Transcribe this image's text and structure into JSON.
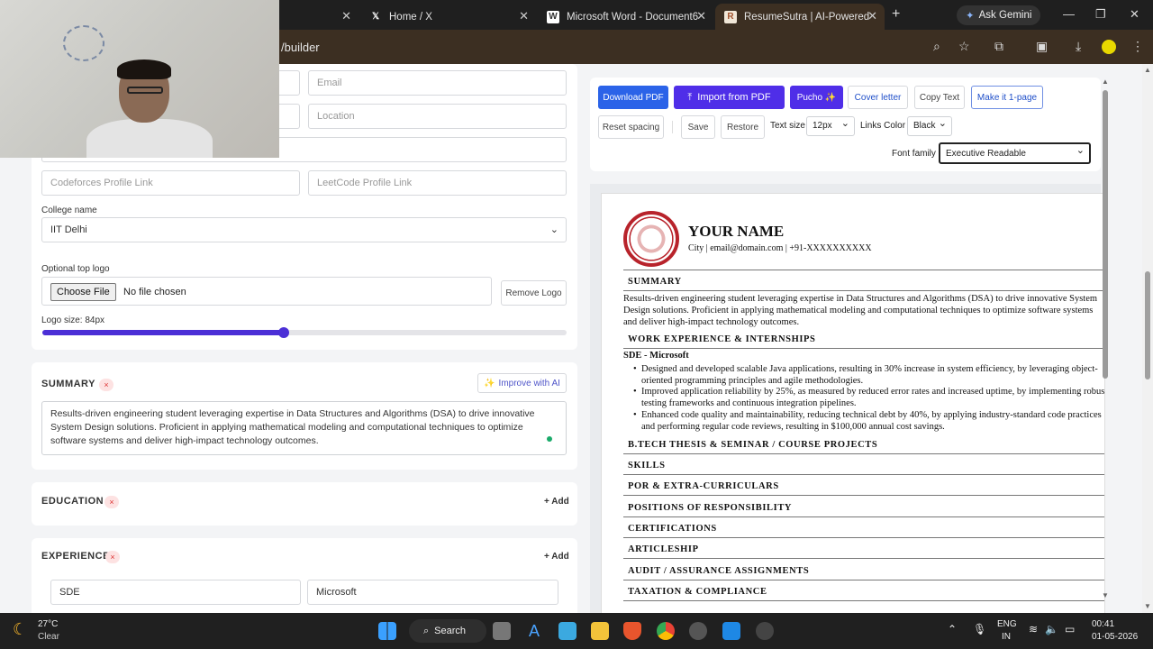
{
  "browser": {
    "tabs": [
      {
        "label": "",
        "favicon": "generic"
      },
      {
        "label": "Home / X",
        "favicon": "x-logo"
      },
      {
        "label": "Microsoft Word - Document6",
        "favicon": "word"
      },
      {
        "label": "ResumeSutra | AI-Powered ATS",
        "favicon": "resume"
      }
    ],
    "new_tab": "+",
    "ask_gemini": "Ask Gemini",
    "url": "/builder"
  },
  "form": {
    "email_placeholder": "Email",
    "location_placeholder": "Location",
    "codeforces_placeholder": "Codeforces Profile Link",
    "leetcode_placeholder": "LeetCode Profile Link",
    "college_label": "College name",
    "college_value": "IIT Delhi",
    "logo_label": "Optional top logo",
    "choose_file": "Choose File",
    "no_file": "No file chosen",
    "remove_logo": "Remove Logo",
    "logo_size_label": "Logo size: 84px",
    "logo_size_fraction": 0.46
  },
  "summary": {
    "title": "SUMMARY",
    "remove": "×",
    "improve": "Improve with AI",
    "text": "Results-driven engineering student leveraging expertise in Data Structures and Algorithms (DSA) to drive innovative System Design solutions. Proficient in applying mathematical modeling and computational techniques to optimize software systems and deliver high-impact technology outcomes."
  },
  "education": {
    "title": "EDUCATION",
    "remove": "×",
    "add": "+ Add"
  },
  "experience": {
    "title": "EXPERIENCE",
    "remove": "×",
    "add": "+ Add",
    "role": "SDE",
    "company": "Microsoft"
  },
  "toolbar": {
    "download_pdf": "Download PDF",
    "import_pdf": "Import from PDF",
    "pucho": "Pucho ✨",
    "cover_letter": "Cover letter",
    "copy_text": "Copy Text",
    "make_1page": "Make it 1-page",
    "reset_spacing": "Reset spacing",
    "save": "Save",
    "restore": "Restore",
    "text_size_label": "Text size",
    "text_size": "12px",
    "links_color_label": "Links Color",
    "links_color": "Black",
    "font_family_label": "Font family",
    "font_family": "Executive Readable"
  },
  "resume": {
    "name": "YOUR NAME",
    "contact": "City | email@domain.com | +91-XXXXXXXXXX",
    "summary_heading": "SUMMARY",
    "summary_text": "Results-driven engineering student leveraging expertise in Data Structures and Algorithms (DSA) to drive innovative System Design solutions. Proficient in applying mathematical modeling and computational techniques to optimize software systems and deliver high-impact technology outcomes.",
    "work_heading": "WORK EXPERIENCE & INTERNSHIPS",
    "job_title": "SDE - Microsoft",
    "bullets": [
      "Designed and developed scalable Java applications, resulting in 30% increase in system efficiency, by leveraging object-oriented programming principles and agile methodologies.",
      "Improved application reliability by 25%, as measured by reduced error rates and increased uptime, by implementing robust testing frameworks and continuous integration pipelines.",
      "Enhanced code quality and maintainability, reducing technical debt by 40%, by applying industry-standard code practices and performing regular code reviews, resulting in $100,000 annual cost savings."
    ],
    "sections": [
      "B.TECH THESIS & SEMINAR / COURSE PROJECTS",
      "SKILLS",
      "POR & EXTRA-CURRICULARS",
      "POSITIONS OF RESPONSIBILITY",
      "CERTIFICATIONS",
      "ARTICLESHIP",
      "AUDIT / ASSURANCE ASSIGNMENTS",
      "TAXATION & COMPLIANCE"
    ]
  },
  "taskbar": {
    "temp": "27°C",
    "weather": "Clear",
    "search": "Search",
    "lang": "ENG",
    "region": "IN",
    "time": "00:41",
    "date": "01-05-2026"
  }
}
